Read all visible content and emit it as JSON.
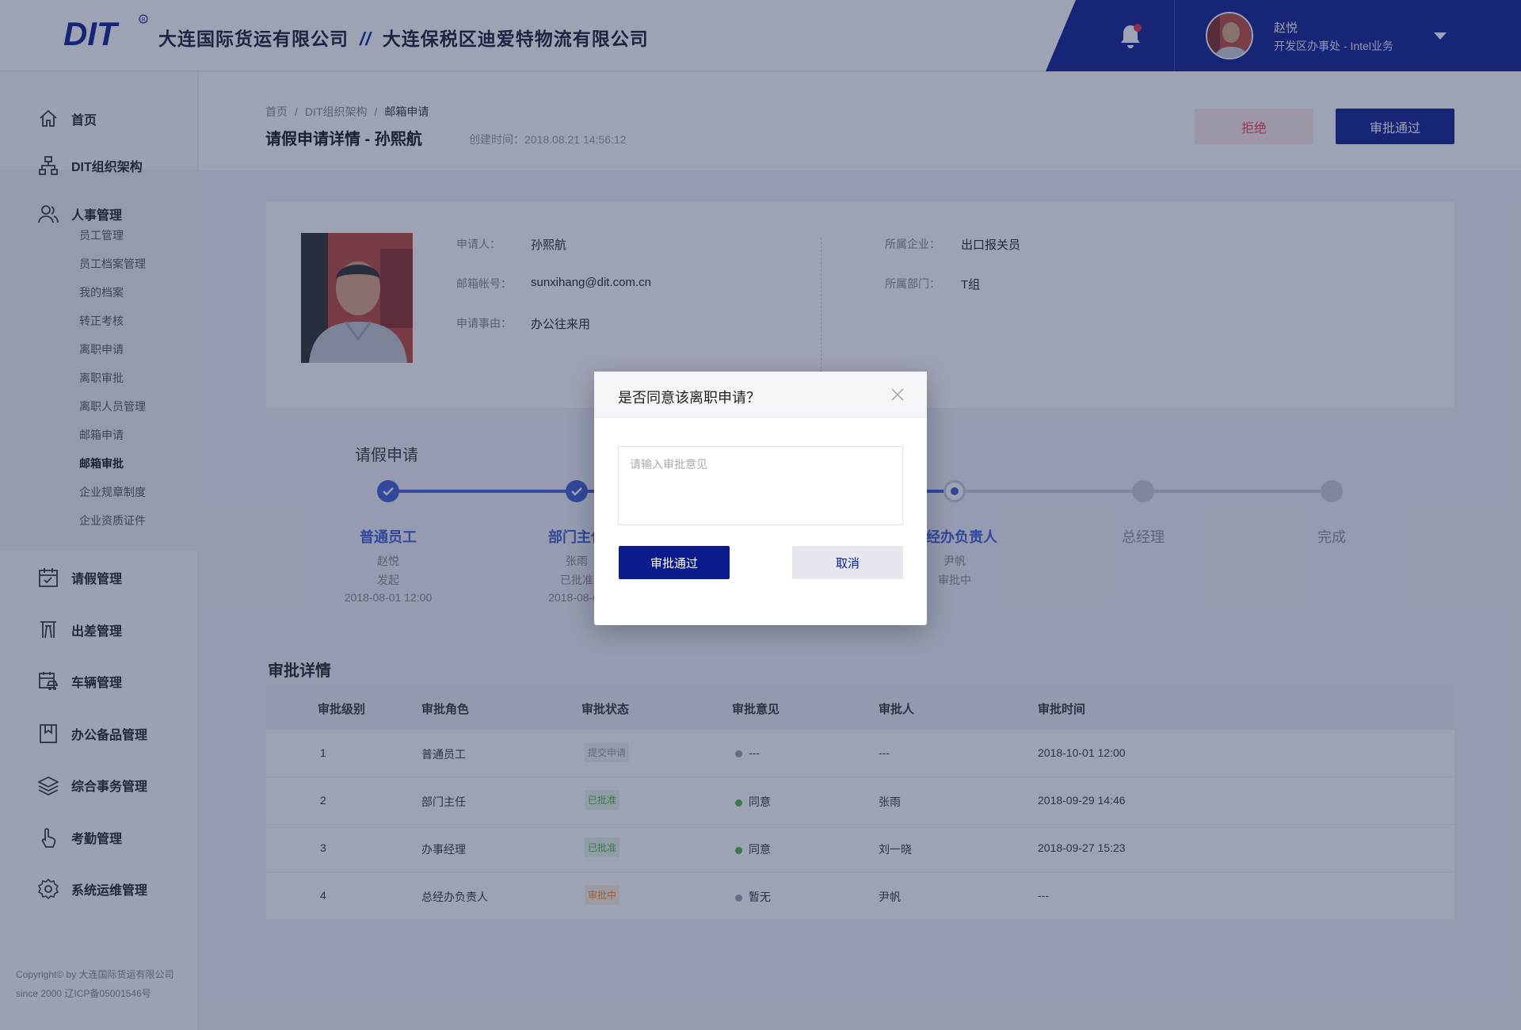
{
  "header": {
    "company_1": "大连国际货运有限公司",
    "separator": "//",
    "company_2": "大连保税区迪爱特物流有限公司",
    "user_name": "赵悦",
    "user_dept": "开发区办事处 - Intel业务"
  },
  "sidebar": {
    "items": [
      {
        "label": "首页",
        "icon": "home-icon"
      },
      {
        "label": "DIT组织架构",
        "icon": "org-chart-icon"
      },
      {
        "label": "人事管理",
        "icon": "users-icon"
      },
      {
        "label": "请假管理",
        "icon": "calendar-icon"
      },
      {
        "label": "出差管理",
        "icon": "travel-icon"
      },
      {
        "label": "车辆管理",
        "icon": "vehicle-icon"
      },
      {
        "label": "办公备品管理",
        "icon": "bookmark-icon"
      },
      {
        "label": "综合事务管理",
        "icon": "layers-icon"
      },
      {
        "label": "考勤管理",
        "icon": "hand-icon"
      },
      {
        "label": "系统运维管理",
        "icon": "gear-icon"
      }
    ],
    "sub_items": [
      "员工管理",
      "员工档案管理",
      "我的档案",
      "转正考核",
      "离职申请",
      "离职审批",
      "离职人员管理",
      "邮箱申请",
      "邮箱审批",
      "企业规章制度",
      "企业资质证件"
    ],
    "active_sub": "邮箱审批",
    "copyright_1": "Copyright© by 大连国际货运有限公司",
    "copyright_2": "since 2000 辽ICP备05001546号"
  },
  "page": {
    "breadcrumb": [
      "首页",
      "DIT组织架构",
      "邮箱申请"
    ],
    "breadcrumb_sep": "/",
    "title": "请假申请详情  -  孙熙航",
    "created": "创建时间：2018.08.21  14:56:12",
    "reject_label": "拒绝",
    "approve_label": "审批通过"
  },
  "applicant": {
    "name_label": "申请人：",
    "name": "孙熙航",
    "email_label": "邮箱帐号：",
    "email": "sunxihang@dit.com.cn",
    "reason_label": "申请事由：",
    "reason": "办公往来用",
    "company_label": "所属企业：",
    "company": "出口报关员",
    "dept_label": "所属部门：",
    "dept": "T组"
  },
  "steps": {
    "title": "请假申请",
    "items": [
      {
        "name": "普通员工",
        "person": "赵悦",
        "status": "发起",
        "time": "2018-08-01 12:00",
        "state": "done"
      },
      {
        "name": "部门主任",
        "person": "张雨",
        "status": "已批准",
        "time": "2018-08-01",
        "state": "done"
      },
      {
        "name": "",
        "person": "",
        "status": "",
        "time": "",
        "state": "done"
      },
      {
        "name": "总经办负责人",
        "person": "尹帆",
        "status": "审批中",
        "time": "",
        "state": "current"
      },
      {
        "name": "总经理",
        "person": "",
        "status": "",
        "time": "",
        "state": "pending"
      },
      {
        "name": "完成",
        "person": "",
        "status": "",
        "time": "",
        "state": "pending"
      }
    ],
    "colors": {
      "done": "#3a5bd0",
      "pending": "#c8ccd6"
    }
  },
  "approval": {
    "title": "审批详情",
    "columns": [
      "审批级别",
      "审批角色",
      "审批状态",
      "审批意见",
      "审批人",
      "审批时间"
    ],
    "rows": [
      {
        "level": "1",
        "role": "普通员工",
        "status": "提交申请",
        "status_type": "grey",
        "opinion": "---",
        "opinion_color": "#9aa0aa",
        "approver": "---",
        "time": "2018-10-01 12:00"
      },
      {
        "level": "2",
        "role": "部门主任",
        "status": "已批准",
        "status_type": "green",
        "opinion": "同意",
        "opinion_color": "#52b03e",
        "approver": "张雨",
        "time": "2018-09-29 14:46"
      },
      {
        "level": "3",
        "role": "办事经理",
        "status": "已批准",
        "status_type": "green",
        "opinion": "同意",
        "opinion_color": "#52b03e",
        "approver": "刘一晓",
        "time": "2018-09-27 15:23"
      },
      {
        "level": "4",
        "role": "总经办负责人",
        "status": "审批中",
        "status_type": "orange",
        "opinion": "暂无",
        "opinion_color": "#9aa0aa",
        "approver": "尹帆",
        "time": "---"
      }
    ]
  },
  "modal": {
    "title": "是否同意该离职申请？",
    "placeholder": "请输入审批意见",
    "ok_label": "审批通过",
    "cancel_label": "取消"
  }
}
